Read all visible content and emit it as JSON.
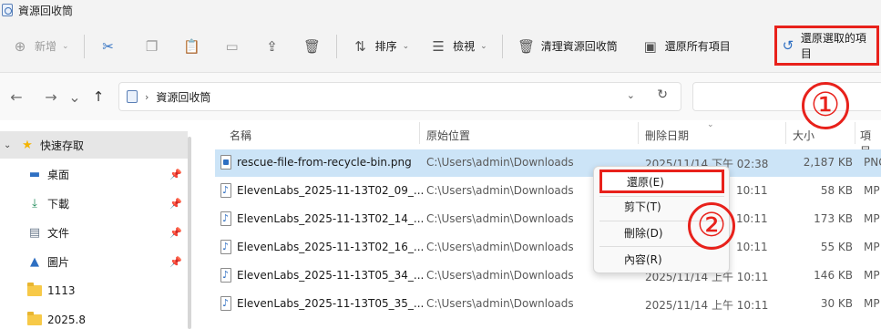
{
  "window": {
    "title": "資源回收筒"
  },
  "toolbar": {
    "new_label": "新增",
    "sort_label": "排序",
    "view_label": "檢視",
    "empty_bin_label": "清理資源回收筒",
    "restore_all_label": "還原所有項目",
    "restore_selected_label": "還原選取的項目"
  },
  "address": {
    "path": "資源回收筒"
  },
  "sidebar": {
    "items": [
      {
        "label": "快速存取",
        "icon": "star-icon"
      },
      {
        "label": "桌面",
        "icon": "desktop-icon"
      },
      {
        "label": "下載",
        "icon": "download-icon"
      },
      {
        "label": "文件",
        "icon": "document-icon"
      },
      {
        "label": "圖片",
        "icon": "pictures-icon"
      },
      {
        "label": "1113",
        "icon": "folder-icon"
      },
      {
        "label": "2025.8",
        "icon": "folder-icon"
      }
    ]
  },
  "columns": {
    "name": "名稱",
    "location": "原始位置",
    "date": "刪除日期",
    "size": "大小",
    "type": "項目"
  },
  "files": [
    {
      "name": "rescue-file-from-recycle-bin.png",
      "location": "C:\\Users\\admin\\Downloads",
      "date": "2025/11/14 下午 02:38",
      "size": "2,187 KB",
      "type": "PNG",
      "icon": "image-file-icon"
    },
    {
      "name": "ElevenLabs_2025-11-13T02_09_...",
      "location": "C:\\Users\\admin\\Downloads",
      "date": "10:11",
      "size": "58 KB",
      "type": "MP",
      "icon": "audio-file-icon"
    },
    {
      "name": "ElevenLabs_2025-11-13T02_14_...",
      "location": "C:\\Users\\admin\\Downloads",
      "date": "10:11",
      "size": "173 KB",
      "type": "MP",
      "icon": "audio-file-icon"
    },
    {
      "name": "ElevenLabs_2025-11-13T02_16_...",
      "location": "C:\\Users\\admin\\Downloads",
      "date": "10:11",
      "size": "55 KB",
      "type": "MP",
      "icon": "audio-file-icon"
    },
    {
      "name": "ElevenLabs_2025-11-13T05_34_...",
      "location": "C:\\Users\\admin\\Downloads",
      "date": "2025/11/14 上午 10:11",
      "size": "146 KB",
      "type": "MP",
      "icon": "audio-file-icon"
    },
    {
      "name": "ElevenLabs_2025-11-13T05_35_...",
      "location": "C:\\Users\\admin\\Downloads",
      "date": "2025/11/14 上午 10:11",
      "size": "30 KB",
      "type": "MP",
      "icon": "audio-file-icon"
    }
  ],
  "context_menu": {
    "items": [
      {
        "label": "還原(E)"
      },
      {
        "label": "剪下(T)"
      },
      {
        "label": "刪除(D)"
      },
      {
        "label": "內容(R)"
      }
    ]
  },
  "annotations": {
    "one": "①",
    "two": "②",
    "color": "#e8211b"
  },
  "colors": {
    "selection": "#cce4f7",
    "accent": "#2e6fc2"
  }
}
